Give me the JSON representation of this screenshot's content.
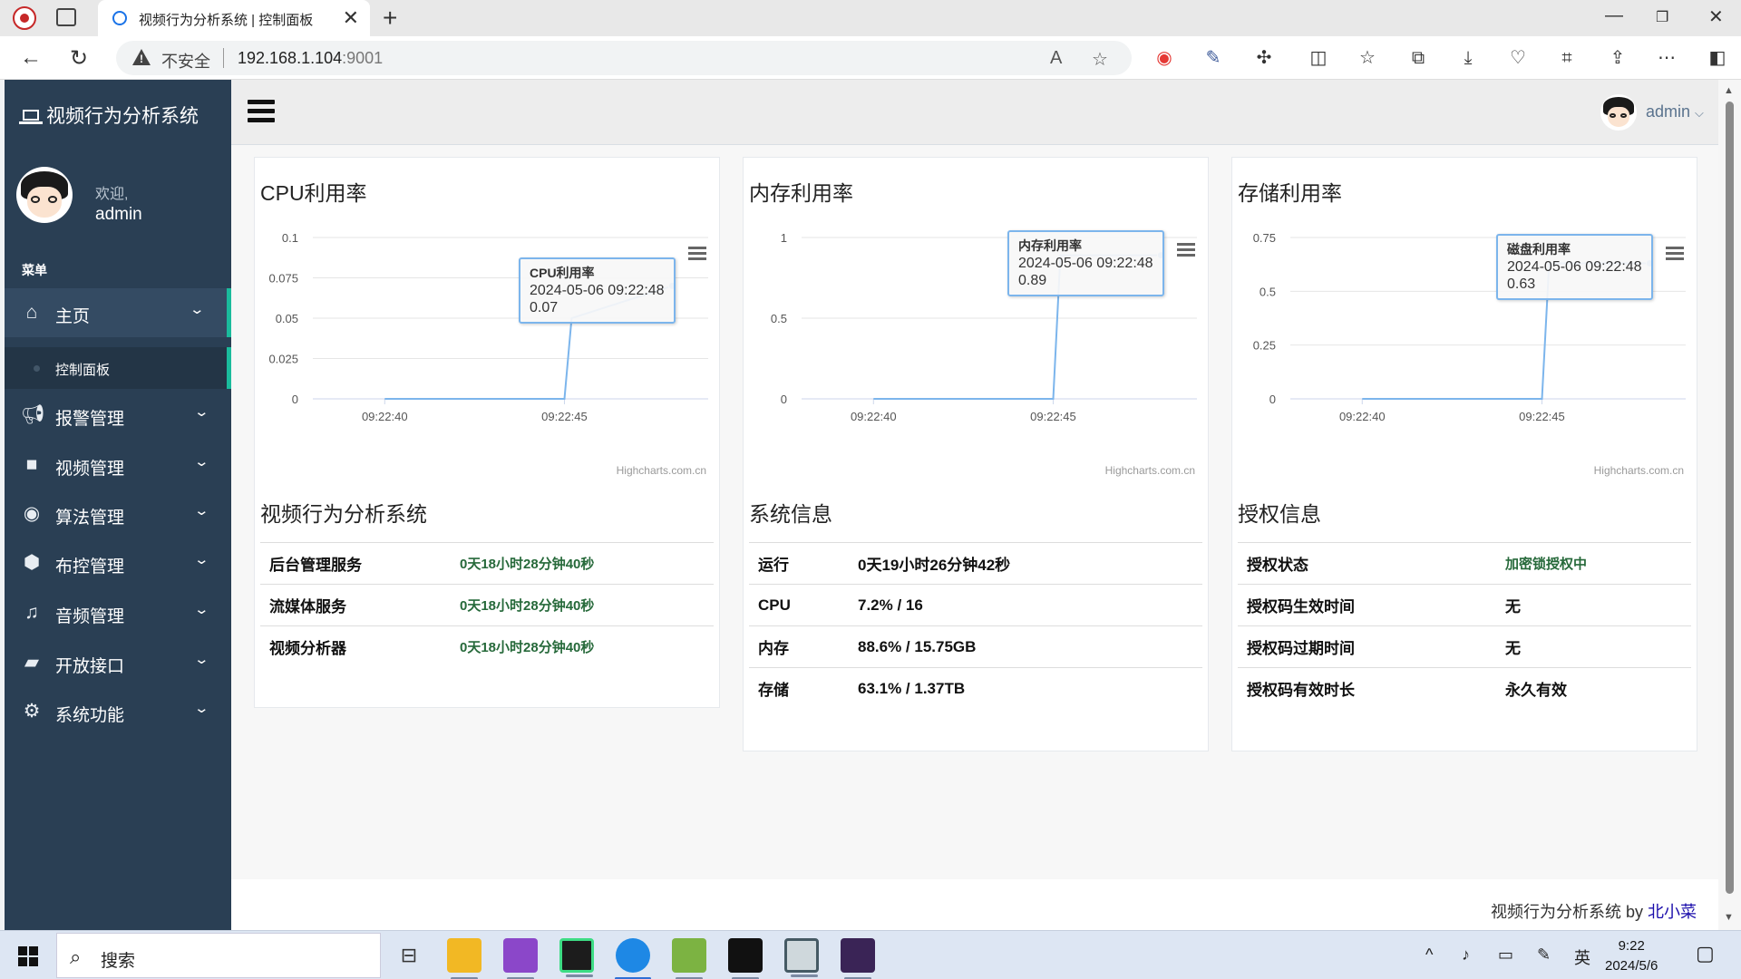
{
  "browser": {
    "tab_title": "视频行为分析系统 | 控制面板",
    "security_label": "不安全",
    "url_host": "192.168.1.104",
    "url_port": ":9001"
  },
  "sidebar": {
    "brand": "视频行为分析系统",
    "welcome": "欢迎,",
    "username": "admin",
    "menu_header": "菜单",
    "items": [
      {
        "label": "主页",
        "icon": "home-icon"
      },
      {
        "label": "报警管理",
        "icon": "bullhorn-icon"
      },
      {
        "label": "视频管理",
        "icon": "video-camera-icon"
      },
      {
        "label": "算法管理",
        "icon": "eye-icon"
      },
      {
        "label": "布控管理",
        "icon": "cube-icon"
      },
      {
        "label": "音频管理",
        "icon": "music-icon"
      },
      {
        "label": "开放接口",
        "icon": "folder-open-icon"
      },
      {
        "label": "系统功能",
        "icon": "gear-icon"
      }
    ],
    "submenu_item": "控制面板"
  },
  "topnav": {
    "user": "admin"
  },
  "charts": {
    "cpu_title": "CPU利用率",
    "mem_title": "内存利用率",
    "disk_title": "存储利用率",
    "credits": "Highcharts.com.cn"
  },
  "chart_data": [
    {
      "type": "line",
      "title": "CPU利用率",
      "x_ticks": [
        "09:22:40",
        "09:22:45"
      ],
      "y_ticks": [
        "0",
        "0.025",
        "0.05",
        "0.075",
        "0.1"
      ],
      "ylim": [
        0,
        0.1
      ],
      "series": [
        {
          "name": "CPU利用率",
          "x": [
            "09:22:40",
            "09:22:45",
            "09:22:45.2",
            "09:22:48"
          ],
          "values": [
            0,
            0,
            0.05,
            0.07
          ]
        }
      ],
      "tooltip": {
        "series": "CPU利用率",
        "time": "2024-05-06 09:22:48",
        "value": "0.07"
      }
    },
    {
      "type": "line",
      "title": "内存利用率",
      "x_ticks": [
        "09:22:40",
        "09:22:45"
      ],
      "y_ticks": [
        "0",
        "0.5",
        "1"
      ],
      "ylim": [
        0,
        1
      ],
      "series": [
        {
          "name": "内存利用率",
          "x": [
            "09:22:40",
            "09:22:45",
            "09:22:45.2",
            "09:22:48"
          ],
          "values": [
            0,
            0,
            0.89,
            0.89
          ]
        }
      ],
      "tooltip": {
        "series": "内存利用率",
        "time": "2024-05-06 09:22:48",
        "value": "0.89"
      }
    },
    {
      "type": "line",
      "title": "存储利用率",
      "x_ticks": [
        "09:22:40",
        "09:22:45"
      ],
      "y_ticks": [
        "0",
        "0.25",
        "0.5",
        "0.75"
      ],
      "ylim": [
        0,
        0.75
      ],
      "series": [
        {
          "name": "磁盘利用率",
          "x": [
            "09:22:40",
            "09:22:45",
            "09:22:45.2",
            "09:22:48"
          ],
          "values": [
            0,
            0,
            0.63,
            0.63
          ]
        }
      ],
      "tooltip": {
        "series": "磁盘利用率",
        "time": "2024-05-06 09:22:48",
        "value": "0.63"
      }
    }
  ],
  "services": {
    "title": "视频行为分析系统",
    "rows": [
      {
        "label": "后台管理服务",
        "value": "0天18小时28分钟40秒"
      },
      {
        "label": "流媒体服务",
        "value": "0天18小时28分钟40秒"
      },
      {
        "label": "视频分析器",
        "value": "0天18小时28分钟40秒"
      }
    ]
  },
  "system": {
    "title": "系统信息",
    "rows": [
      {
        "label": "运行",
        "value": "0天19小时26分钟42秒"
      },
      {
        "label": "CPU",
        "value": "7.2% / 16"
      },
      {
        "label": "内存",
        "value": "88.6% / 15.75GB"
      },
      {
        "label": "存储",
        "value": "63.1% / 1.37TB"
      }
    ]
  },
  "license": {
    "title": "授权信息",
    "rows": [
      {
        "label": "授权状态",
        "value": "加密锁授权中"
      },
      {
        "label": "授权码生效时间",
        "value": "无"
      },
      {
        "label": "授权码过期时间",
        "value": "无"
      },
      {
        "label": "授权码有效时长",
        "value": "永久有效"
      }
    ]
  },
  "footer": {
    "text": "视频行为分析系统 by ",
    "link": "北小菜"
  },
  "taskbar": {
    "search_placeholder": "搜索",
    "ime": "英",
    "time": "9:22",
    "date": "2024/5/6"
  },
  "colors": {
    "sidebar_bg": "#2a3f54",
    "accent": "#1abb9c",
    "series_line": "#7cb5ec",
    "uptime_green": "#26693a"
  }
}
